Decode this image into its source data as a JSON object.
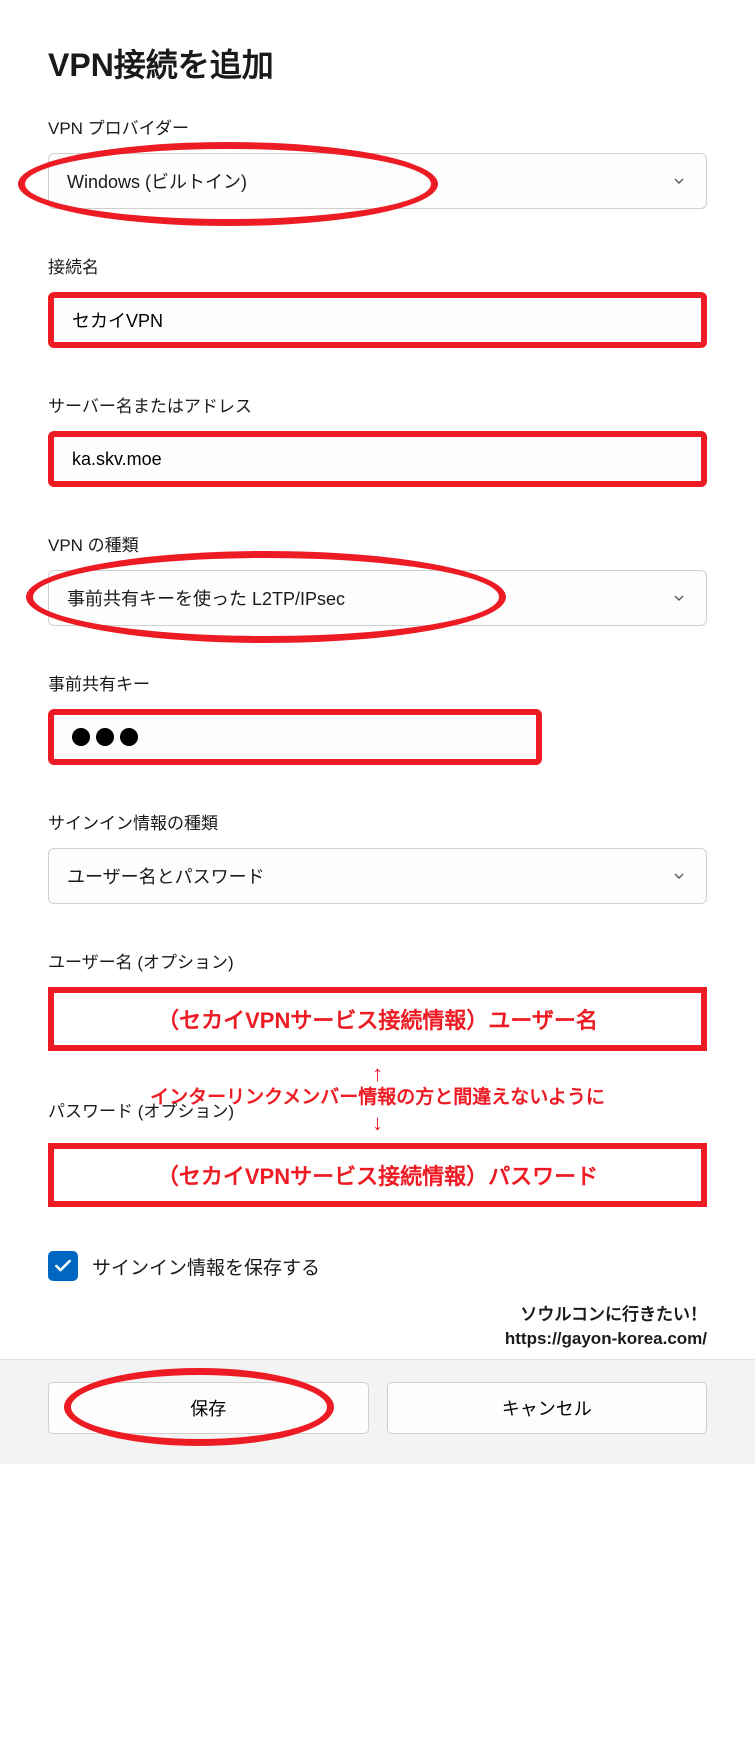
{
  "title": "VPN接続を追加",
  "provider": {
    "label": "VPN プロバイダー",
    "value": "Windows (ビルトイン)"
  },
  "connection_name": {
    "label": "接続名",
    "value": "セカイVPN"
  },
  "server": {
    "label": "サーバー名またはアドレス",
    "value": "ka.skv.moe"
  },
  "vpn_type": {
    "label": "VPN の種類",
    "value": "事前共有キーを使った L2TP/IPsec"
  },
  "psk": {
    "label": "事前共有キー"
  },
  "signin_type": {
    "label": "サインイン情報の種類",
    "value": "ユーザー名とパスワード"
  },
  "username": {
    "label": "ユーザー名 (オプション)",
    "hint": "（セカイVPNサービス接続情報）ユーザー名"
  },
  "middle_note": {
    "arrow_up": "↑",
    "text": "インターリンクメンバー情報の方と間違えないように",
    "arrow_down": "↓"
  },
  "password": {
    "label": "パスワード (オプション)",
    "hint": "（セカイVPNサービス接続情報）パスワード"
  },
  "save_signin": {
    "label": "サインイン情報を保存する",
    "checked": true
  },
  "watermark": {
    "line1": "ソウルコンに行きたい！",
    "line2": "https://gayon-korea.com/"
  },
  "buttons": {
    "save": "保存",
    "cancel": "キャンセル"
  }
}
